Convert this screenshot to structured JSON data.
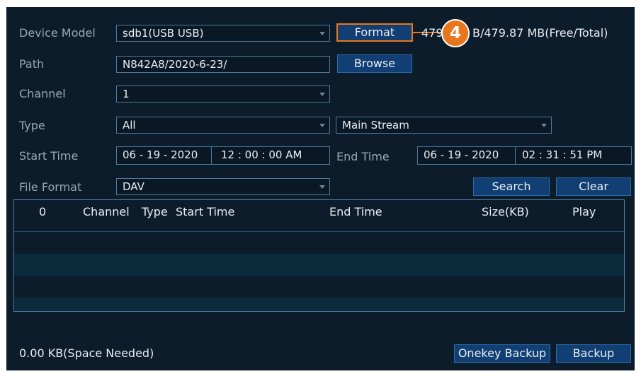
{
  "form": {
    "device_model": {
      "label": "Device Model",
      "value": "sdb1(USB USB)"
    },
    "format_button": "Format",
    "capacity_text": "479.",
    "capacity_text_2": "B/479.87 MB(Free/Total)",
    "callout_number": "4",
    "path": {
      "label": "Path",
      "value": "N842A8/2020-6-23/"
    },
    "browse_button": "Browse",
    "channel": {
      "label": "Channel",
      "value": "1"
    },
    "type": {
      "label": "Type",
      "value": "All",
      "stream": "Main Stream"
    },
    "start_time": {
      "label": "Start Time",
      "date": "06 - 19 - 2020",
      "time": "12 : 00 : 00 AM"
    },
    "end_time": {
      "label": "End Time",
      "date": "06 - 19 - 2020",
      "time": "02 : 31 : 51 PM"
    },
    "file_format": {
      "label": "File Format",
      "value": "DAV"
    },
    "search_button": "Search",
    "clear_button": "Clear"
  },
  "table": {
    "columns": [
      "0",
      "Channel",
      "Type",
      "Start Time",
      "End Time",
      "Size(KB)",
      "Play"
    ],
    "rows": []
  },
  "footer": {
    "space_needed": "0.00 KB(Space Needed)",
    "onekey_backup_button": "Onekey Backup",
    "backup_button": "Backup"
  },
  "colors": {
    "panel_bg": "#0c1c2b",
    "button_bg": "#113f73",
    "highlight": "#e8761c",
    "row_alt": "#0b2a3c"
  }
}
